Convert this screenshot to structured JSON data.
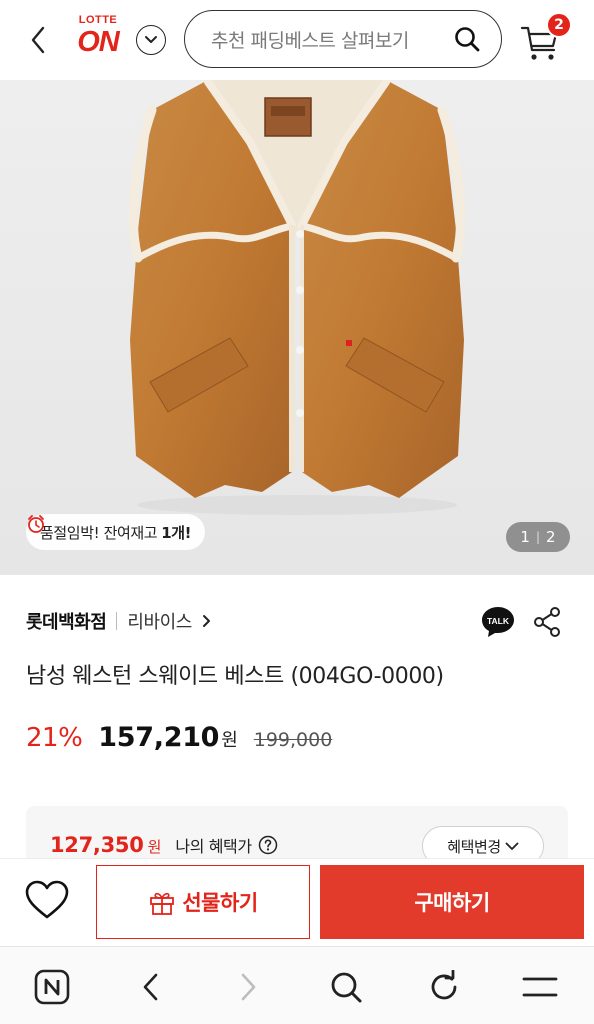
{
  "header": {
    "logo_top": "LOTTE",
    "logo_main": "ON",
    "search_placeholder": "추천 패딩베스트 살펴보기",
    "cart_count": "2"
  },
  "gallery": {
    "stock_notice_prefix": "품절임박! 잔여재고 ",
    "stock_notice_count": "1개!",
    "page_current": "1",
    "page_total": "2"
  },
  "product": {
    "store": "롯데백화점",
    "brand": "리바이스",
    "title": "남성 웨스턴 스웨이드 베스트 (004GO-0000)",
    "discount": "21%",
    "price": "157,210",
    "currency": "원",
    "original_price": "199,000"
  },
  "benefit": {
    "price": "127,350",
    "currency": "원",
    "label": "나의 혜택가",
    "change_label": "혜택변경"
  },
  "actions": {
    "gift_label": "선물하기",
    "buy_label": "구매하기"
  },
  "icons": {
    "back": "chevron-left-icon",
    "search": "search-icon",
    "cart": "cart-icon",
    "talk": "talk-icon",
    "share": "share-icon",
    "heart": "heart-icon",
    "gift": "gift-icon"
  },
  "colors": {
    "brand_red": "#e3241b",
    "buy_button": "#e33b2b",
    "suede": "#c17a33"
  }
}
